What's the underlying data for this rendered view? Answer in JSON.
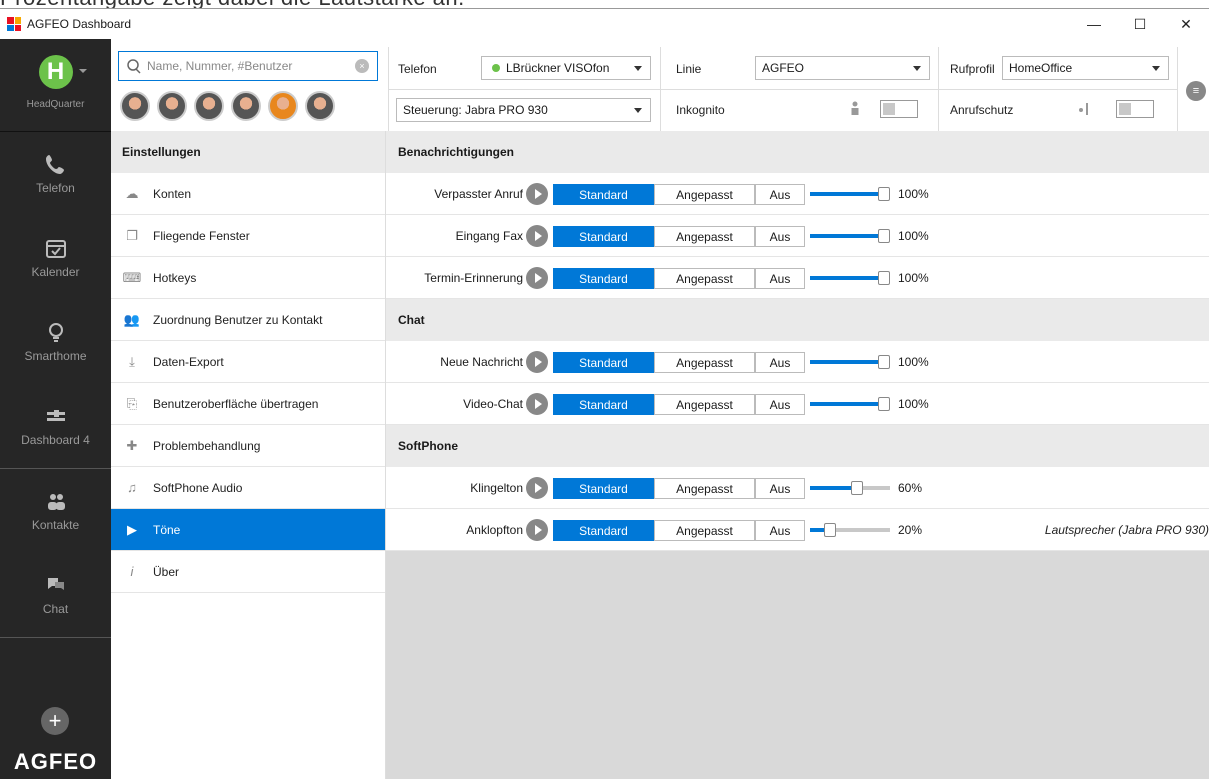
{
  "caption": "Prozentangabe zeigt dabei die Lautstärke an.",
  "window": {
    "title": "AGFEO Dashboard",
    "min": "—",
    "max": "☐",
    "close": "✕"
  },
  "rail": {
    "hq_initial": "H",
    "hq_label": "HeadQuarter",
    "items": [
      {
        "label": "Telefon",
        "icon": "phone-icon"
      },
      {
        "label": "Kalender",
        "icon": "calendar-icon"
      },
      {
        "label": "Smarthome",
        "icon": "bulb-icon"
      },
      {
        "label": "Dashboard 4",
        "icon": "dashboard-icon"
      },
      {
        "label": "Kontakte",
        "icon": "contacts-icon"
      },
      {
        "label": "Chat",
        "icon": "chat-icon"
      }
    ],
    "plus": "+",
    "logo": "AGFEO"
  },
  "search": {
    "placeholder": "Name, Nummer, #Benutzer",
    "clear": "×"
  },
  "topbar": {
    "telefon_label": "Telefon",
    "telefon_value": "LBrückner VISOfon",
    "linie_label": "Linie",
    "linie_value": "AGFEO",
    "rufprofil_label": "Rufprofil",
    "rufprofil_value": "HomeOffice",
    "steuerung_value": "Steuerung: Jabra PRO 930",
    "inkognito_label": "Inkognito",
    "anrufschutz_label": "Anrufschutz",
    "menu": "≡"
  },
  "settings": {
    "heading": "Einstellungen",
    "items": [
      {
        "label": "Konten",
        "icon": "cloud-icon",
        "glyph": "☁"
      },
      {
        "label": "Fliegende Fenster",
        "icon": "window-icon",
        "glyph": "❐"
      },
      {
        "label": "Hotkeys",
        "icon": "keyboard-icon",
        "glyph": "⌨"
      },
      {
        "label": "Zuordnung Benutzer zu Kontakt",
        "icon": "users-icon",
        "glyph": "👥"
      },
      {
        "label": "Daten-Export",
        "icon": "download-icon",
        "glyph": "⤓"
      },
      {
        "label": "Benutzeroberfläche übertragen",
        "icon": "transfer-icon",
        "glyph": "⎘"
      },
      {
        "label": "Problembehandlung",
        "icon": "plus-cross-icon",
        "glyph": "✚"
      },
      {
        "label": "SoftPhone Audio",
        "icon": "headset-icon",
        "glyph": "♫"
      },
      {
        "label": "Töne",
        "icon": "play-arrow-icon",
        "glyph": "▶"
      },
      {
        "label": "Über",
        "icon": "info-icon",
        "glyph": "i"
      }
    ]
  },
  "options": {
    "standard": "Standard",
    "angepasst": "Angepasst",
    "aus": "Aus"
  },
  "sections": [
    {
      "title": "Benachrichtigungen",
      "rows": [
        {
          "label": "Verpasster Anruf",
          "volume": 100,
          "pct": "100%"
        },
        {
          "label": "Eingang Fax",
          "volume": 100,
          "pct": "100%"
        },
        {
          "label": "Termin-Erinnerung",
          "volume": 100,
          "pct": "100%"
        }
      ]
    },
    {
      "title": "Chat",
      "rows": [
        {
          "label": "Neue Nachricht",
          "volume": 100,
          "pct": "100%"
        },
        {
          "label": "Video-Chat",
          "volume": 100,
          "pct": "100%"
        }
      ]
    },
    {
      "title": "SoftPhone",
      "rows": [
        {
          "label": "Klingelton",
          "volume": 60,
          "pct": "60%"
        },
        {
          "label": "Anklopfton",
          "volume": 20,
          "pct": "20%",
          "extra": "Lautsprecher (Jabra PRO 930)"
        }
      ]
    }
  ],
  "colors": {
    "accent": "#0078d7",
    "rail": "#262626",
    "status_green": "#6cc24a"
  }
}
